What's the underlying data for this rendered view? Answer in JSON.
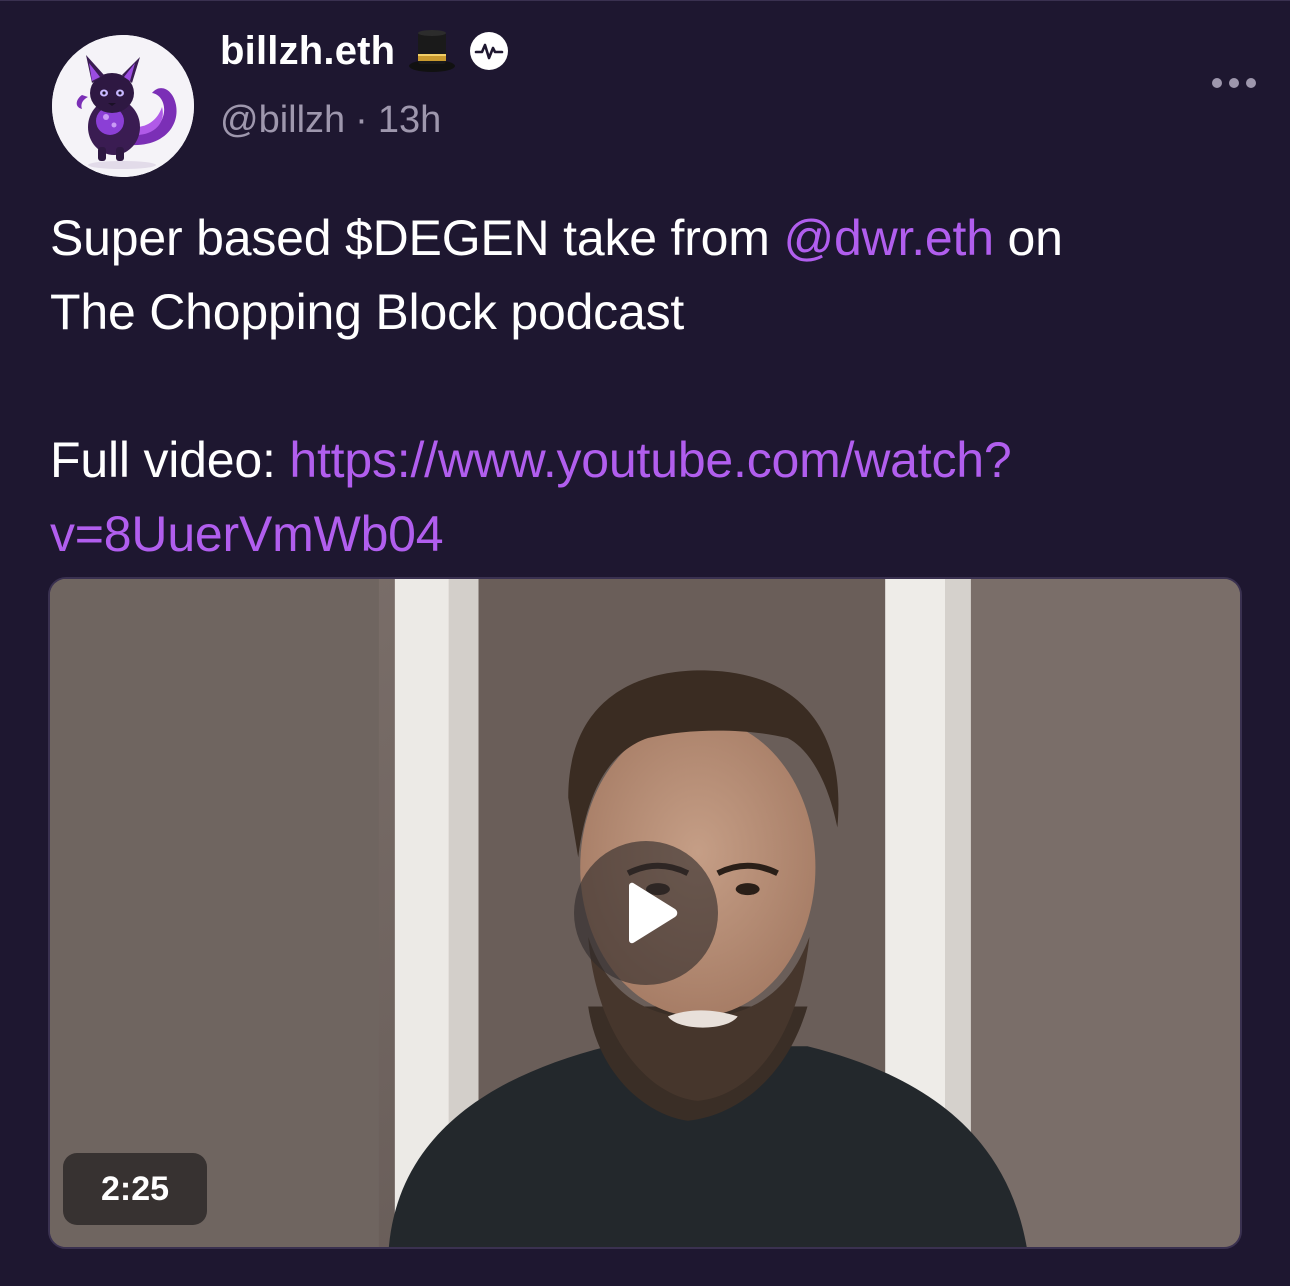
{
  "post": {
    "display_name": "billzh.eth",
    "handle": "@billzh",
    "separator": "·",
    "time": "13h",
    "text": {
      "line1_pre": "Super based $DEGEN take from ",
      "mention": "@dwr.eth",
      "line1_post": " on",
      "line2": "The Chopping Block podcast",
      "line3_pre": "Full video: ",
      "url_line1": "https://www.youtube.com/watch?",
      "url_line2": "v=8UuerVmWb04"
    },
    "video": {
      "duration": "2:25"
    }
  },
  "icons": {
    "badge_emoji": "top-hat-icon",
    "verified_badge": "activity-badge-icon",
    "more": "more-horizontal-icon",
    "play": "play-icon"
  },
  "colors": {
    "background": "#1e1730",
    "link": "#b15eee",
    "muted": "#9e97ad"
  }
}
